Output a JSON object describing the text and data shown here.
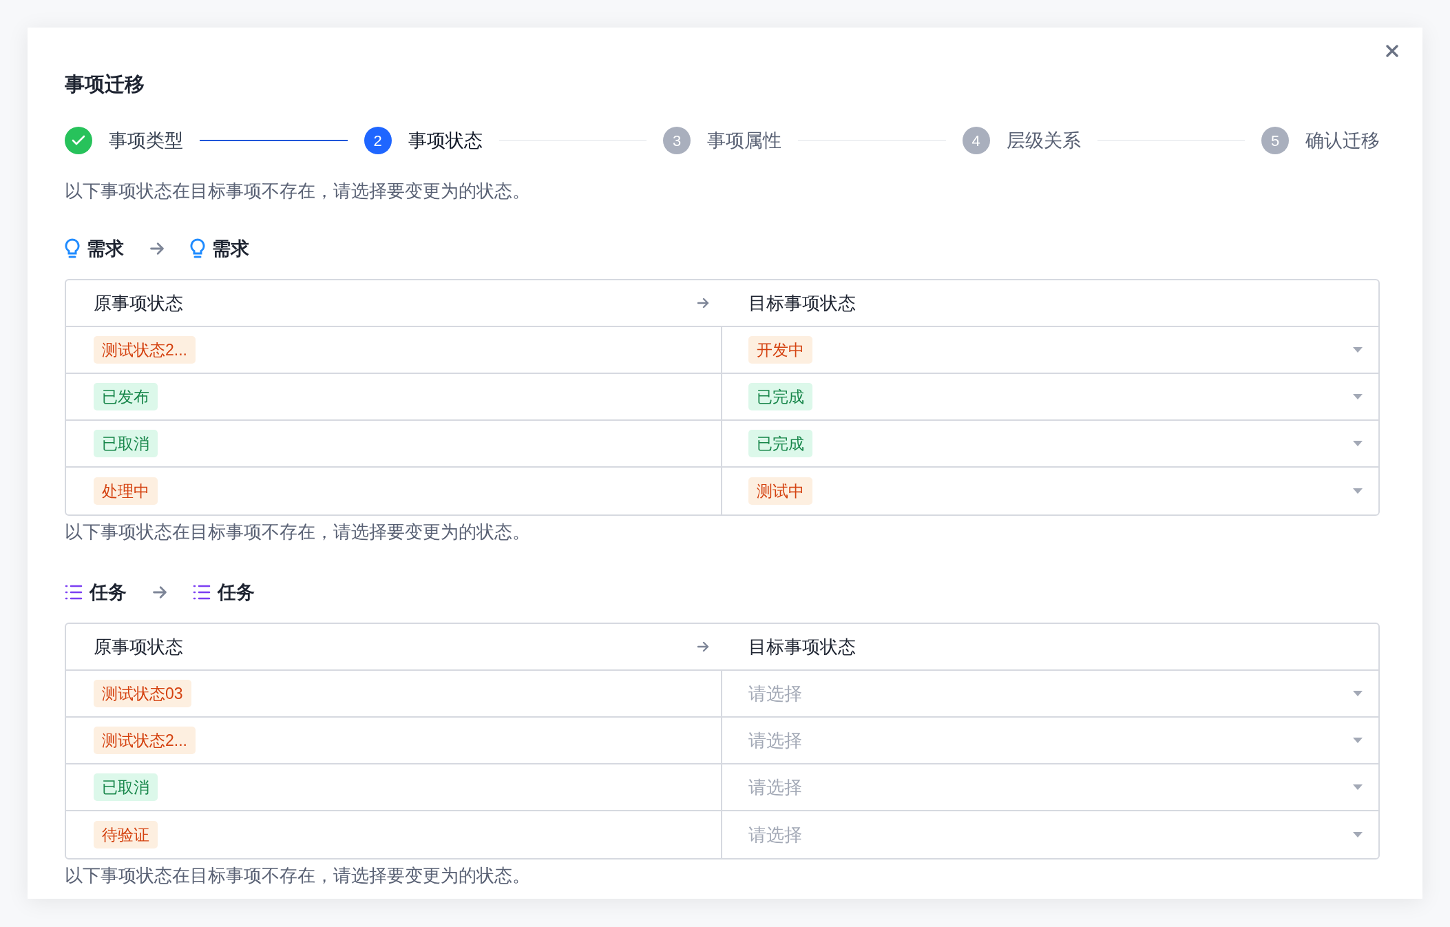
{
  "dialog": {
    "title": "事项迁移"
  },
  "steps": [
    {
      "label": "事项类型",
      "done": true,
      "selected": false
    },
    {
      "number": "2",
      "label": "事项状态",
      "done": false,
      "selected": true
    },
    {
      "number": "3",
      "label": "事项属性",
      "done": false,
      "selected": false
    },
    {
      "number": "4",
      "label": "层级关系",
      "done": false,
      "selected": false
    },
    {
      "number": "5",
      "label": "确认迁移",
      "done": false,
      "selected": false
    }
  ],
  "intro": "以下事项状态在目标事项不存在，请选择要变更为的状态。",
  "sections": [
    {
      "from": {
        "label": "需求",
        "kind": "requirement"
      },
      "to": {
        "label": "需求",
        "kind": "requirement"
      },
      "columns": [
        "原事项状态",
        "目标事项状态"
      ],
      "rows": [
        {
          "source": {
            "text": "测试状态2...",
            "kind": "warning"
          },
          "target": {
            "text": "开发中",
            "kind": "warning"
          }
        },
        {
          "source": {
            "text": "已发布",
            "kind": "success"
          },
          "target": {
            "text": "已完成",
            "kind": "success"
          }
        },
        {
          "source": {
            "text": "已取消",
            "kind": "success"
          },
          "target": {
            "text": "已完成",
            "kind": "success"
          }
        },
        {
          "source": {
            "text": "处理中",
            "kind": "warning"
          },
          "target": {
            "text": "测试中",
            "kind": "warning"
          }
        }
      ],
      "note": "以下事项状态在目标事项不存在，请选择要变更为的状态。"
    },
    {
      "from": {
        "label": "任务",
        "kind": "task"
      },
      "to": {
        "label": "任务",
        "kind": "task"
      },
      "columns": [
        "原事项状态",
        "目标事项状态"
      ],
      "rows": [
        {
          "source": {
            "text": "测试状态03",
            "kind": "warning"
          },
          "target": {
            "placeholder": "请选择"
          }
        },
        {
          "source": {
            "text": "测试状态2...",
            "kind": "warning"
          },
          "target": {
            "placeholder": "请选择"
          }
        },
        {
          "source": {
            "text": "已取消",
            "kind": "success"
          },
          "target": {
            "placeholder": "请选择"
          }
        },
        {
          "source": {
            "text": "待验证",
            "kind": "warning"
          },
          "target": {
            "placeholder": "请选择"
          }
        }
      ],
      "note": "以下事项状态在目标事项不存在，请选择要变更为的状态。"
    }
  ]
}
